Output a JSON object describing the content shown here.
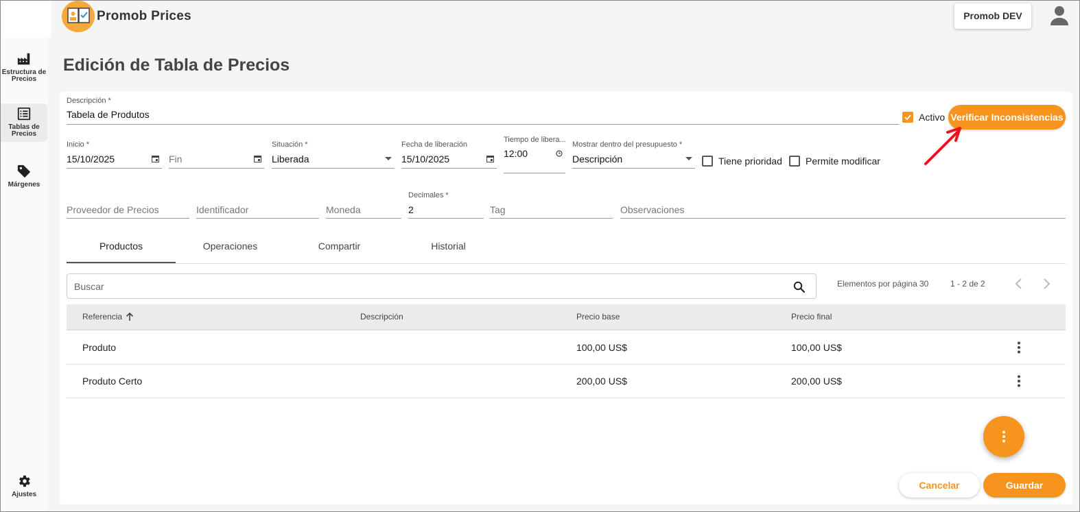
{
  "app": {
    "title": "Promob Prices",
    "environment_button": "Promob DEV",
    "logo_icon": "promob-logo-icon",
    "user_icon": "user-account-icon"
  },
  "sidebar": {
    "items": [
      {
        "label": "Estructura de Precios",
        "icon": "factory-icon",
        "active": false
      },
      {
        "label": "Tablas de Precios",
        "icon": "list-icon",
        "active": true
      },
      {
        "label": "Márgenes",
        "icon": "tag-icon",
        "active": false
      }
    ],
    "settings_label": "Ajustes",
    "settings_icon": "gear-icon"
  },
  "page": {
    "title": "Edición de Tabla de Precios"
  },
  "form": {
    "descripcion": {
      "label": "Descripción *",
      "value": "Tabela de Produtos"
    },
    "activo": {
      "label": "Activo",
      "checked": true
    },
    "verify_button": "Verificar Inconsistencias",
    "inicio": {
      "label": "Inicio *",
      "value": "15/10/2025"
    },
    "fin": {
      "placeholder": "Fin",
      "value": ""
    },
    "situacion": {
      "label": "Situación *",
      "value": "Liberada"
    },
    "fecha_liberacion": {
      "label": "Fecha de liberación",
      "value": "15/10/2025"
    },
    "tiempo_liberacion": {
      "label": "Tiempo de libera...",
      "value": "12:00"
    },
    "mostrar": {
      "label": "Mostrar dentro del presupuesto *",
      "value": "Descripción"
    },
    "tiene_prioridad": {
      "label": "Tiene prioridad",
      "checked": false
    },
    "permite_modificar": {
      "label": "Permite modificar",
      "checked": false
    },
    "proveedor": {
      "placeholder": "Proveedor de Precios"
    },
    "identificador": {
      "placeholder": "Identificador"
    },
    "moneda": {
      "placeholder": "Moneda"
    },
    "decimales": {
      "label": "Decimales *",
      "value": "2"
    },
    "tag": {
      "placeholder": "Tag"
    },
    "observaciones": {
      "placeholder": "Observaciones"
    }
  },
  "tabs": [
    {
      "label": "Productos",
      "active": true
    },
    {
      "label": "Operaciones",
      "active": false
    },
    {
      "label": "Compartir",
      "active": false
    },
    {
      "label": "Historial",
      "active": false
    }
  ],
  "search": {
    "placeholder": "Buscar"
  },
  "paginator": {
    "items_per_page_label": "Elementos por página",
    "items_per_page": "30",
    "range": "1 - 2 de 2"
  },
  "table": {
    "headers": [
      "Referencia",
      "Descripción",
      "Precio base",
      "Precio final"
    ],
    "sort_indicator": "arrow-up-icon",
    "rows": [
      {
        "referencia": "Produto",
        "descripcion": "",
        "precio_base": "100,00 US$",
        "precio_final": "100,00 US$"
      },
      {
        "referencia": "Produto Certo",
        "descripcion": "",
        "precio_base": "200,00 US$",
        "precio_final": "200,00 US$"
      }
    ]
  },
  "actions": {
    "cancel": "Cancelar",
    "save": "Guardar"
  },
  "colors": {
    "accent": "#f7941d",
    "annotation_arrow": "#e8141e"
  }
}
